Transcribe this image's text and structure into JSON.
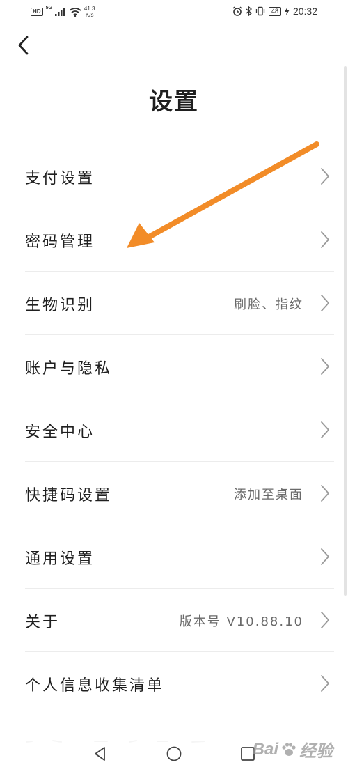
{
  "status_bar": {
    "hd": "HD",
    "network": "5G",
    "speed_value": "41.3",
    "speed_unit": "K/s",
    "battery": "48",
    "time": "20:32"
  },
  "header": {
    "title": "设置"
  },
  "items": [
    {
      "label": "支付设置",
      "value": ""
    },
    {
      "label": "密码管理",
      "value": ""
    },
    {
      "label": "生物识别",
      "value": "刷脸、指纹"
    },
    {
      "label": "账户与隐私",
      "value": ""
    },
    {
      "label": "安全中心",
      "value": ""
    },
    {
      "label": "快捷码设置",
      "value": "添加至桌面"
    },
    {
      "label": "通用设置",
      "value": ""
    },
    {
      "label": "关于",
      "value": "版本号 V10.88.10"
    },
    {
      "label": "个人信息收集清单",
      "value": ""
    }
  ],
  "annotation": {
    "arrow_color": "#f28c28"
  },
  "watermark": {
    "text_left": "Bai",
    "text_right": "经验"
  }
}
